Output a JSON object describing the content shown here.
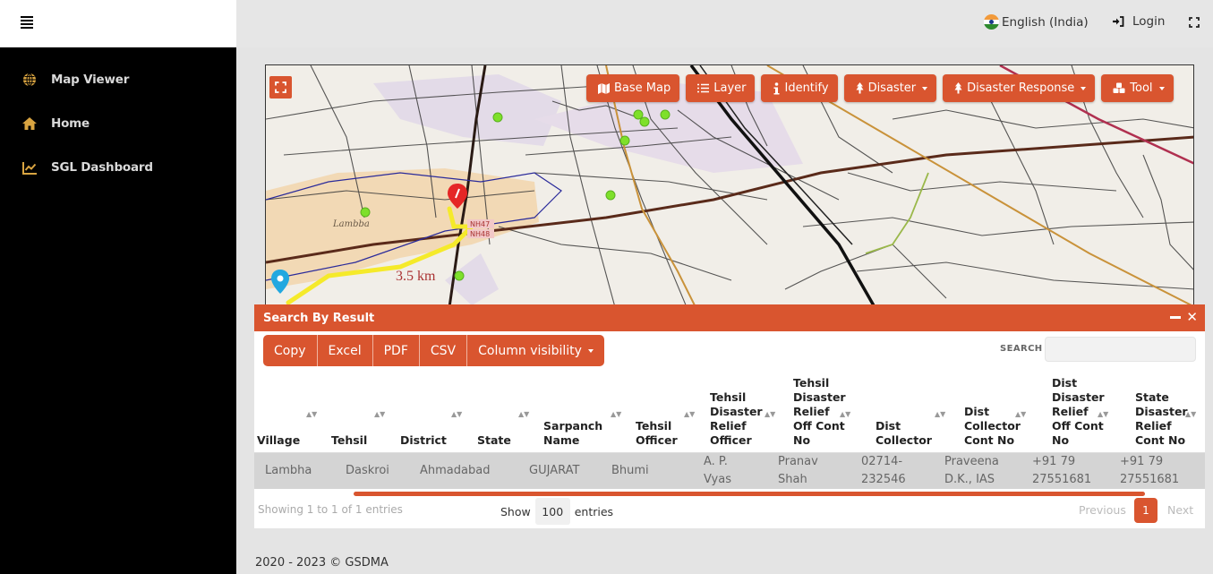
{
  "sidebar": {
    "items": [
      {
        "label": "Map Viewer",
        "icon": "globe-icon"
      },
      {
        "label": "Home",
        "icon": "home-icon"
      },
      {
        "label": "SGL Dashboard",
        "icon": "chart-line-icon"
      }
    ],
    "icon_color": "#d9a441"
  },
  "header": {
    "language": "English (India)",
    "login": "Login"
  },
  "map": {
    "toolbar": [
      {
        "label": "Base Map",
        "icon": "map-icon",
        "dropdown": false
      },
      {
        "label": "Layer",
        "icon": "list-icon",
        "dropdown": false
      },
      {
        "label": "Identify",
        "icon": "info-icon",
        "dropdown": false
      },
      {
        "label": "Disaster",
        "icon": "tree-icon",
        "dropdown": true
      },
      {
        "label": "Disaster Response",
        "icon": "tree-icon",
        "dropdown": true
      },
      {
        "label": "Tool",
        "icon": "cubes-icon",
        "dropdown": true
      }
    ],
    "labels": {
      "place": "Lambba",
      "route_distance": "3.5 km",
      "road_1": "NH47",
      "road_2": "NH48"
    }
  },
  "panel": {
    "title": "Search By Result",
    "buttons": [
      "Copy",
      "Excel",
      "PDF",
      "CSV",
      "Column visibility"
    ],
    "search_label": "SEARCH",
    "search_value": "",
    "columns": [
      "Village",
      "Tehsil",
      "District",
      "State",
      "Sarpanch Name",
      "Tehsil Officer",
      "Tehsil Disaster Relief Officer",
      "Tehsil Disaster Relief Off Cont No",
      "Dist Collector",
      "Dist Collector Cont No",
      "Dist Disaster Relief Off Cont No",
      "State Disaster Relief Cont No"
    ],
    "rows": [
      [
        "Lambha",
        "Daskroi",
        "Ahmadabad",
        "GUJARAT",
        "Bhumi",
        "A. P. Vyas",
        "Pranav Shah",
        "02714-232546",
        "Praveena D.K., IAS",
        "+91 79 27551681",
        "+91 79 27551681"
      ]
    ],
    "info": "Showing 1 to 1 of 1 entries",
    "show_label": "Show",
    "show_value": "100",
    "entries_label": "entries",
    "pagination": {
      "previous": "Previous",
      "current": "1",
      "next": "Next"
    }
  },
  "footer": {
    "copyright": "2020 - 2023 © GSDMA"
  },
  "colors": {
    "accent": "#d9552f",
    "sidebar_bg": "#000000",
    "row_bg": "#d4d4d4"
  }
}
